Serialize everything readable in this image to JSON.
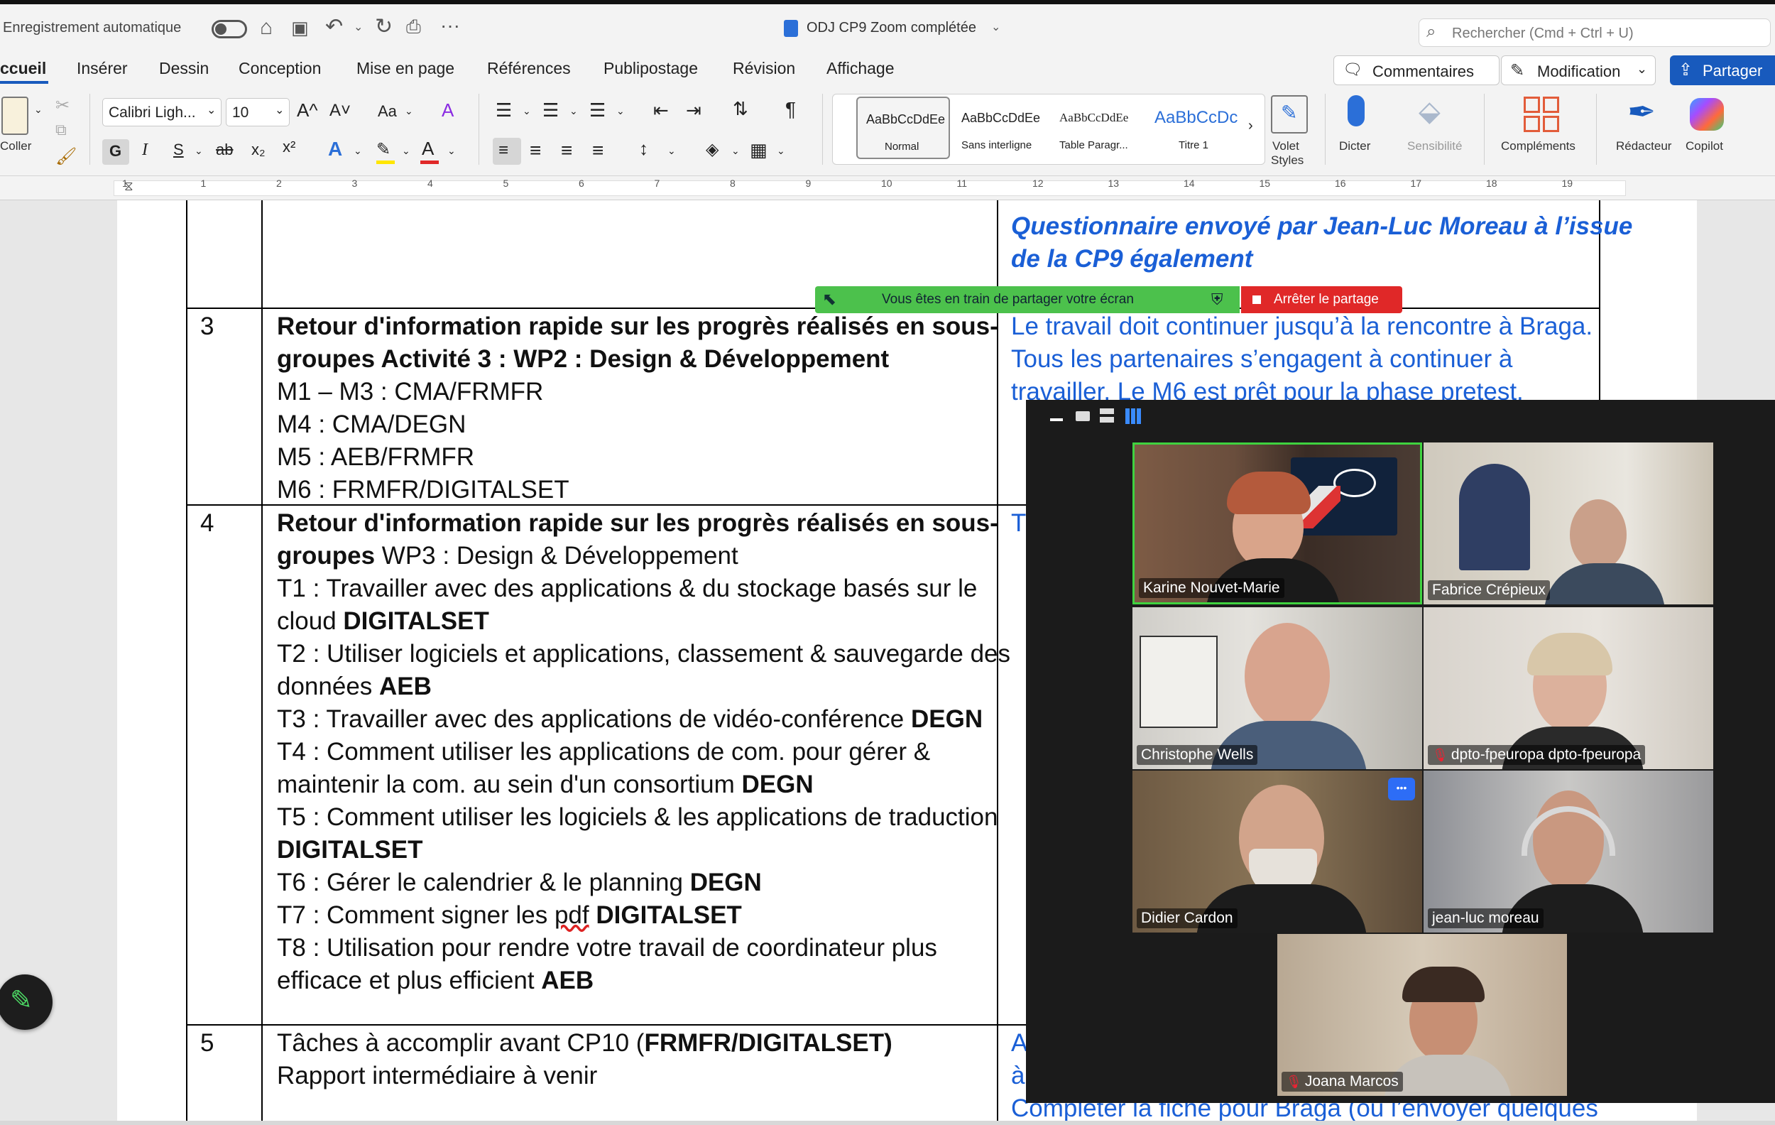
{
  "window": {
    "autosave_label": "Enregistrement automatique",
    "doc_title": "ODJ CP9 Zoom complétée",
    "search_placeholder": "Rechercher (Cmd + Ctrl + U)"
  },
  "tabs": [
    "ccueil",
    "Insérer",
    "Dessin",
    "Conception",
    "Mise en page",
    "Références",
    "Publipostage",
    "Révision",
    "Affichage"
  ],
  "actions": {
    "comments": "Commentaires",
    "editing": "Modification",
    "share": "Partager"
  },
  "ribbon": {
    "paste": "Coller",
    "font_name": "Calibri Ligh...",
    "font_size": "10",
    "bold": "G",
    "italic": "I",
    "underline": "S",
    "strike": "ab",
    "sub": "x₂",
    "sup": "x²",
    "grow": "A^",
    "shrink": "A˅",
    "case": "Aa",
    "clear": "A",
    "styles": [
      {
        "preview": "AaBbCcDdEe",
        "label": "Normal"
      },
      {
        "preview": "AaBbCcDdEe",
        "label": "Sans interligne"
      },
      {
        "preview": "AaBbCcDdEe",
        "label": "Table Paragr..."
      },
      {
        "preview": "AaBbCcDc",
        "label": "Titre 1"
      }
    ],
    "styles_pane_1": "Volet",
    "styles_pane_2": "Styles",
    "dictate": "Dicter",
    "sensitivity": "Sensibilité",
    "addins": "Compléments",
    "editor": "Rédacteur",
    "copilot": "Copilot"
  },
  "ruler": [
    "1",
    "1",
    "2",
    "3",
    "4",
    "5",
    "6",
    "7",
    "8",
    "9",
    "10",
    "11",
    "12",
    "13",
    "14",
    "15",
    "16",
    "17",
    "18",
    "19"
  ],
  "document": {
    "row2_right_1": "Questionnaire envoyé par Jean-Luc Moreau à l’issue",
    "row2_right_2": "de la CP9 également",
    "row3_num": "3",
    "row3_title_1": "Retour d'information rapide sur les progrès réalisés en sous-",
    "row3_title_2": "groupes Activité 3 : WP2 : Design & Développement",
    "row3_lines": [
      "M1 – M3 : CMA/FRMFR",
      "M4 : CMA/DEGN",
      "M5 : AEB/FRMFR",
      "M6 : FRMFR/DIGITALSET"
    ],
    "row3_right_1": "Le travail doit continuer jusqu’à la rencontre à Braga.",
    "row3_right_2": "Tous les partenaires s’engagent à continuer à",
    "row3_right_3": "travailler. Le M6 est prêt pour la phase pretest.",
    "row4_num": "4",
    "row4_title_1": "Retour d'information rapide sur les progrès réalisés en sous-",
    "row4_title_2a": "groupes",
    "row4_title_2b": " WP3 : Design & Développement",
    "row4_right": "T",
    "t1a": "T1 : Travailler avec des applications & du stockage basés sur le",
    "t1b": "cloud ",
    "t1c": "DIGITALSET",
    "t2a": "T2 : Utiliser logiciels et applications, classement & sauvegarde des",
    "t2b": "données ",
    "t2c": "AEB",
    "t3a": "T3 : Travailler avec des applications de vidéo-conférence ",
    "t3b": "DEGN",
    "t4a": "T4 : Comment utiliser les applications de com. pour gérer &",
    "t4b": "maintenir la com. au sein d'un consortium ",
    "t4c": "DEGN",
    "t5a": "T5 : Comment utiliser les logiciels & les applications de traduction",
    "t5b": "DIGITALSET",
    "t6a": "T6 : Gérer le calendrier & le planning ",
    "t6b": "DEGN",
    "t7a": "T7 : Comment signer les ",
    "t7b": "pdf",
    "t7c": " DIGITALSET",
    "t8a": "T8 : Utilisation pour rendre votre travail de coordinateur plus",
    "t8b": "efficace et plus efficient ",
    "t8c": "AEB",
    "row5_num": "5",
    "row5_title_a": "Tâches à accomplir avant CP10 (",
    "row5_title_b": "FRMFR/DIGITALSET)",
    "row5_line2": "Rapport intermédiaire à venir",
    "row5_right_1": "A",
    "row5_right_2": "à",
    "row5_right_3": "Compléter la fiche pour Braga (ou l’envoyer quelques"
  },
  "share_banner": {
    "message": "Vous êtes en train de partager votre écran",
    "stop": "Arrêter le partage"
  },
  "participants": [
    {
      "name": "Karine Nouvet-Marie",
      "muted": false,
      "active": true
    },
    {
      "name": "Fabrice Crépieux",
      "muted": false
    },
    {
      "name": "Christophe Wells",
      "muted": false
    },
    {
      "name": "dpto-fpeuropa dpto-fpeuropa",
      "muted": true
    },
    {
      "name": "Didier Cardon",
      "muted": false
    },
    {
      "name": "jean-luc moreau",
      "muted": false
    },
    {
      "name": "Joana Marcos",
      "muted": true
    }
  ],
  "tile_more": "•••",
  "colors": {
    "accent": "#185abd",
    "link_blue": "#1a5fd6",
    "share_green": "#4cc14c",
    "stop_red": "#e02828",
    "active_border": "#3fd23f"
  }
}
